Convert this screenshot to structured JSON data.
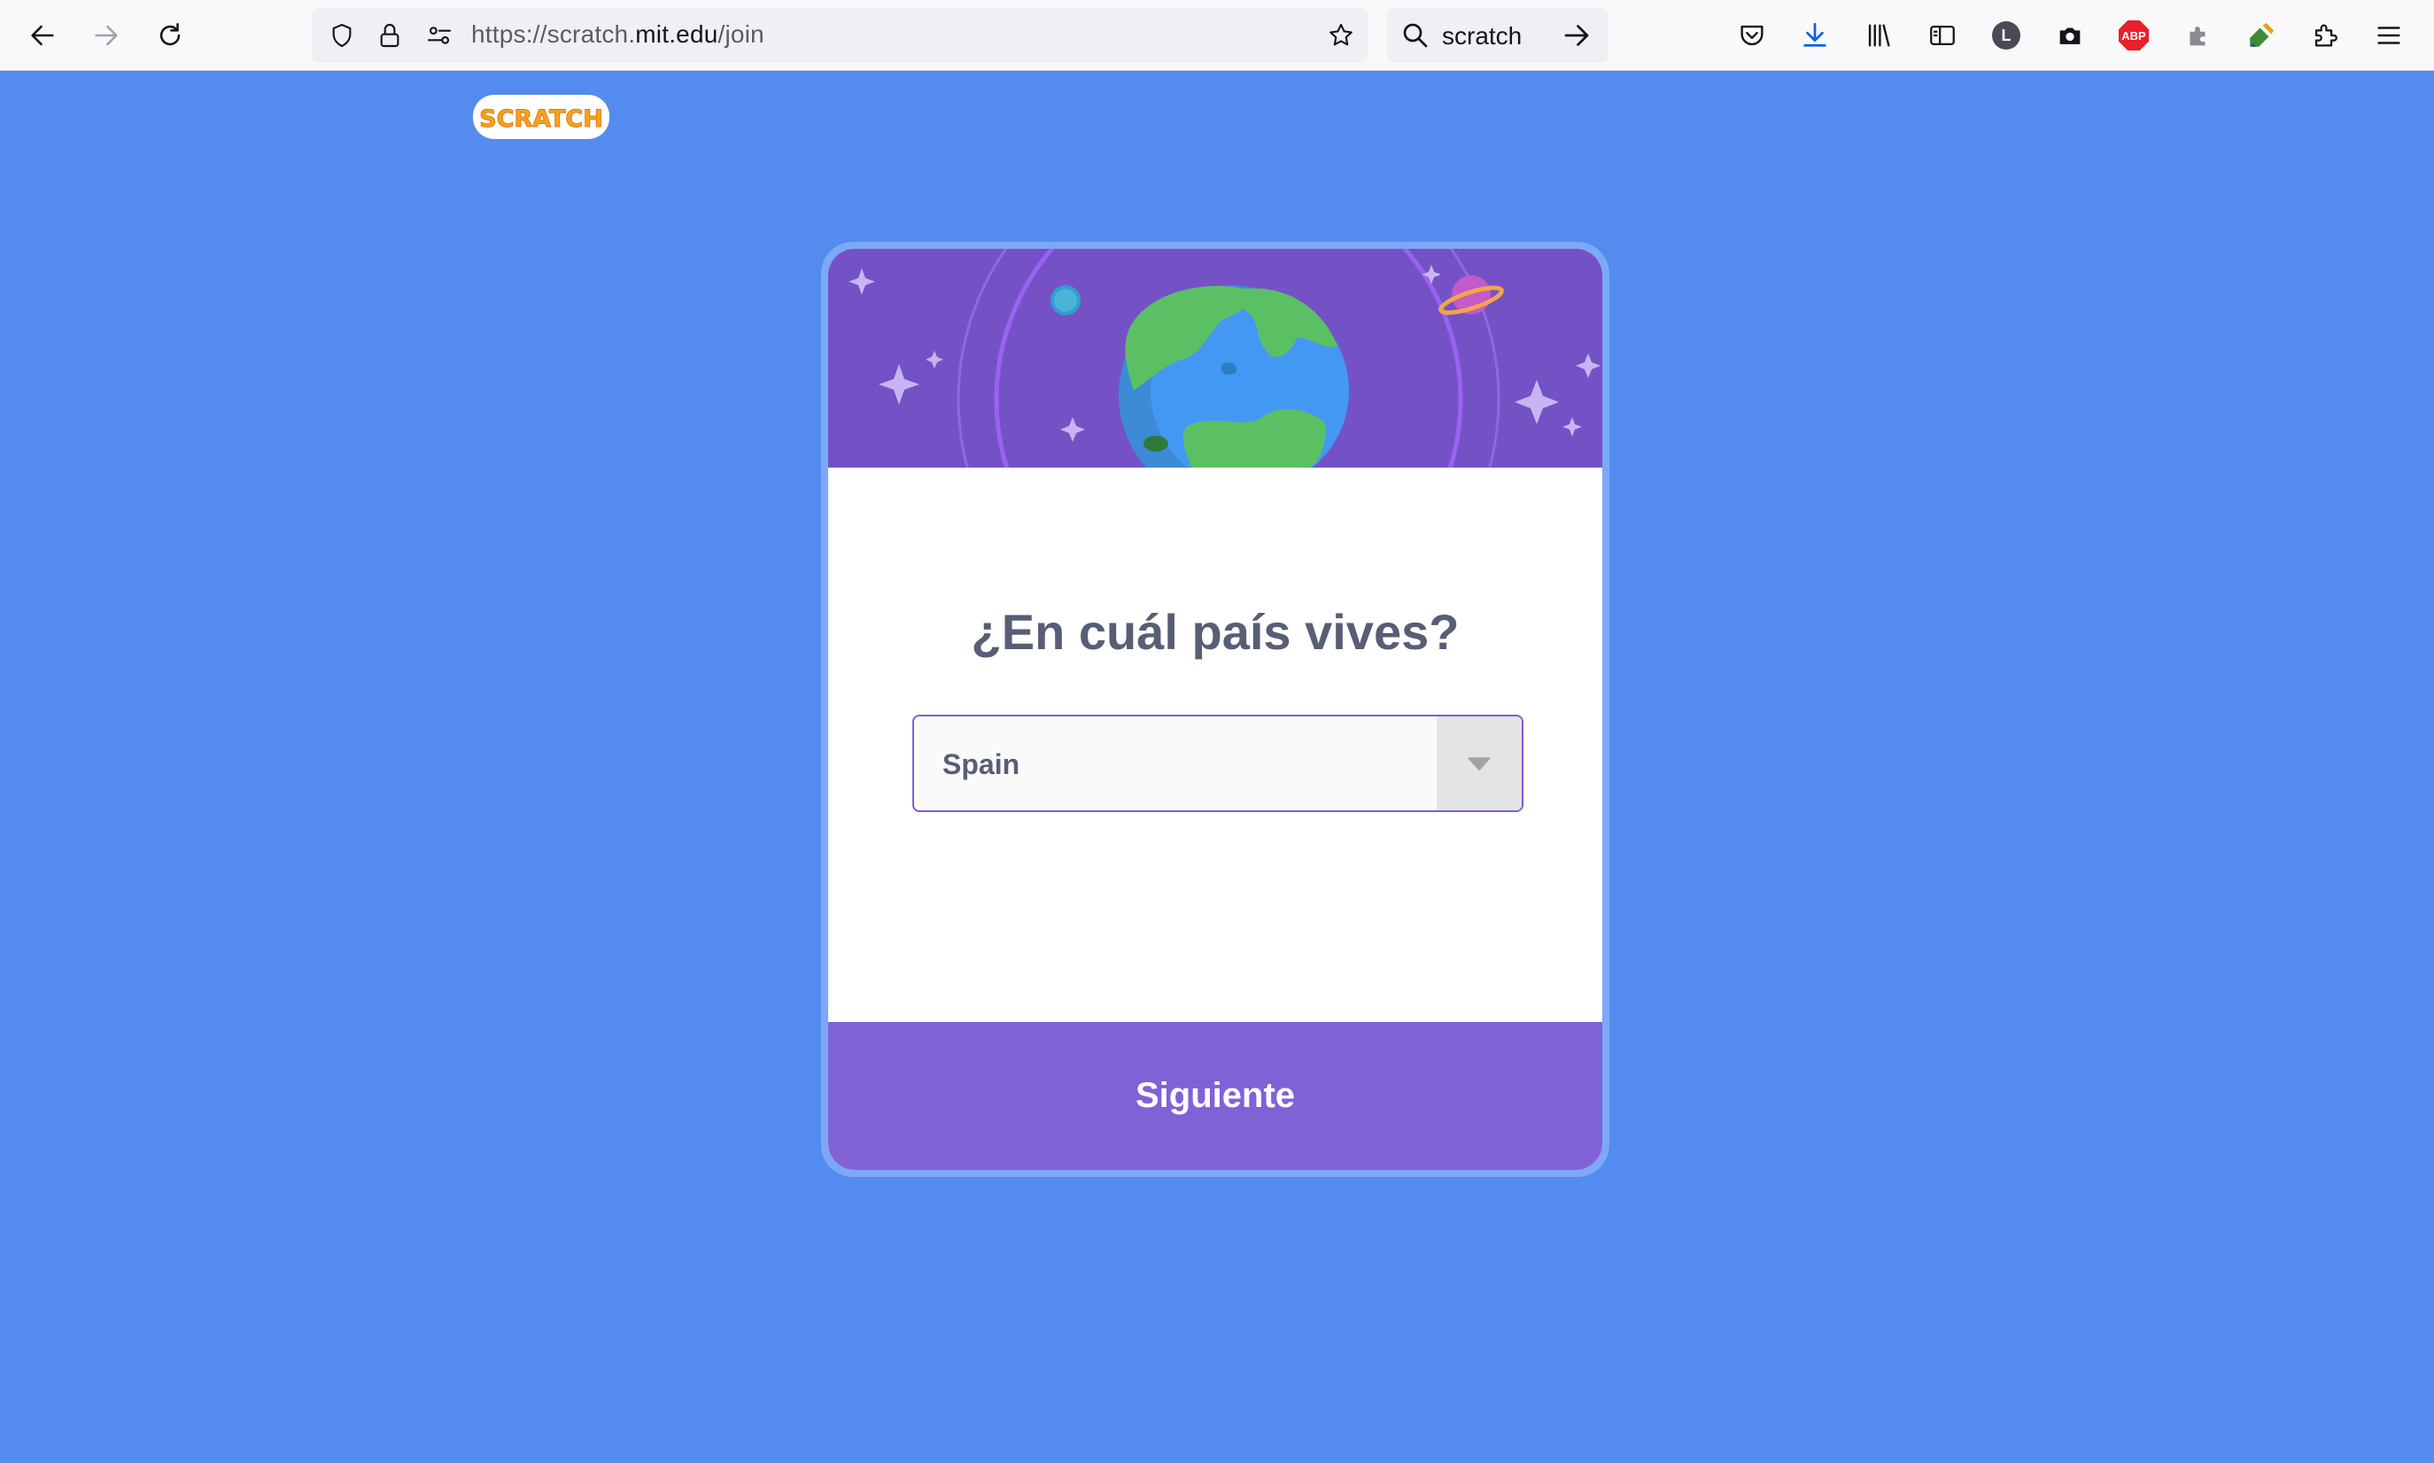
{
  "browser": {
    "url_prefix": "https://scratch.",
    "url_host": "mit.edu",
    "url_path": "/join",
    "search_text": "scratch",
    "profile_letter": "L",
    "adblock_label": "ABP"
  },
  "page": {
    "logo_text": "SCRATCH",
    "question": "¿En cuál país vives?",
    "country_select_value": "Spain",
    "next_button_label": "Siguiente"
  },
  "colors": {
    "page_background": "#548bee",
    "banner": "#7452c6",
    "button": "#8062d6",
    "select_border": "#855cd6",
    "heading_text": "#575e75",
    "logo_orange": "#f7a21d"
  }
}
